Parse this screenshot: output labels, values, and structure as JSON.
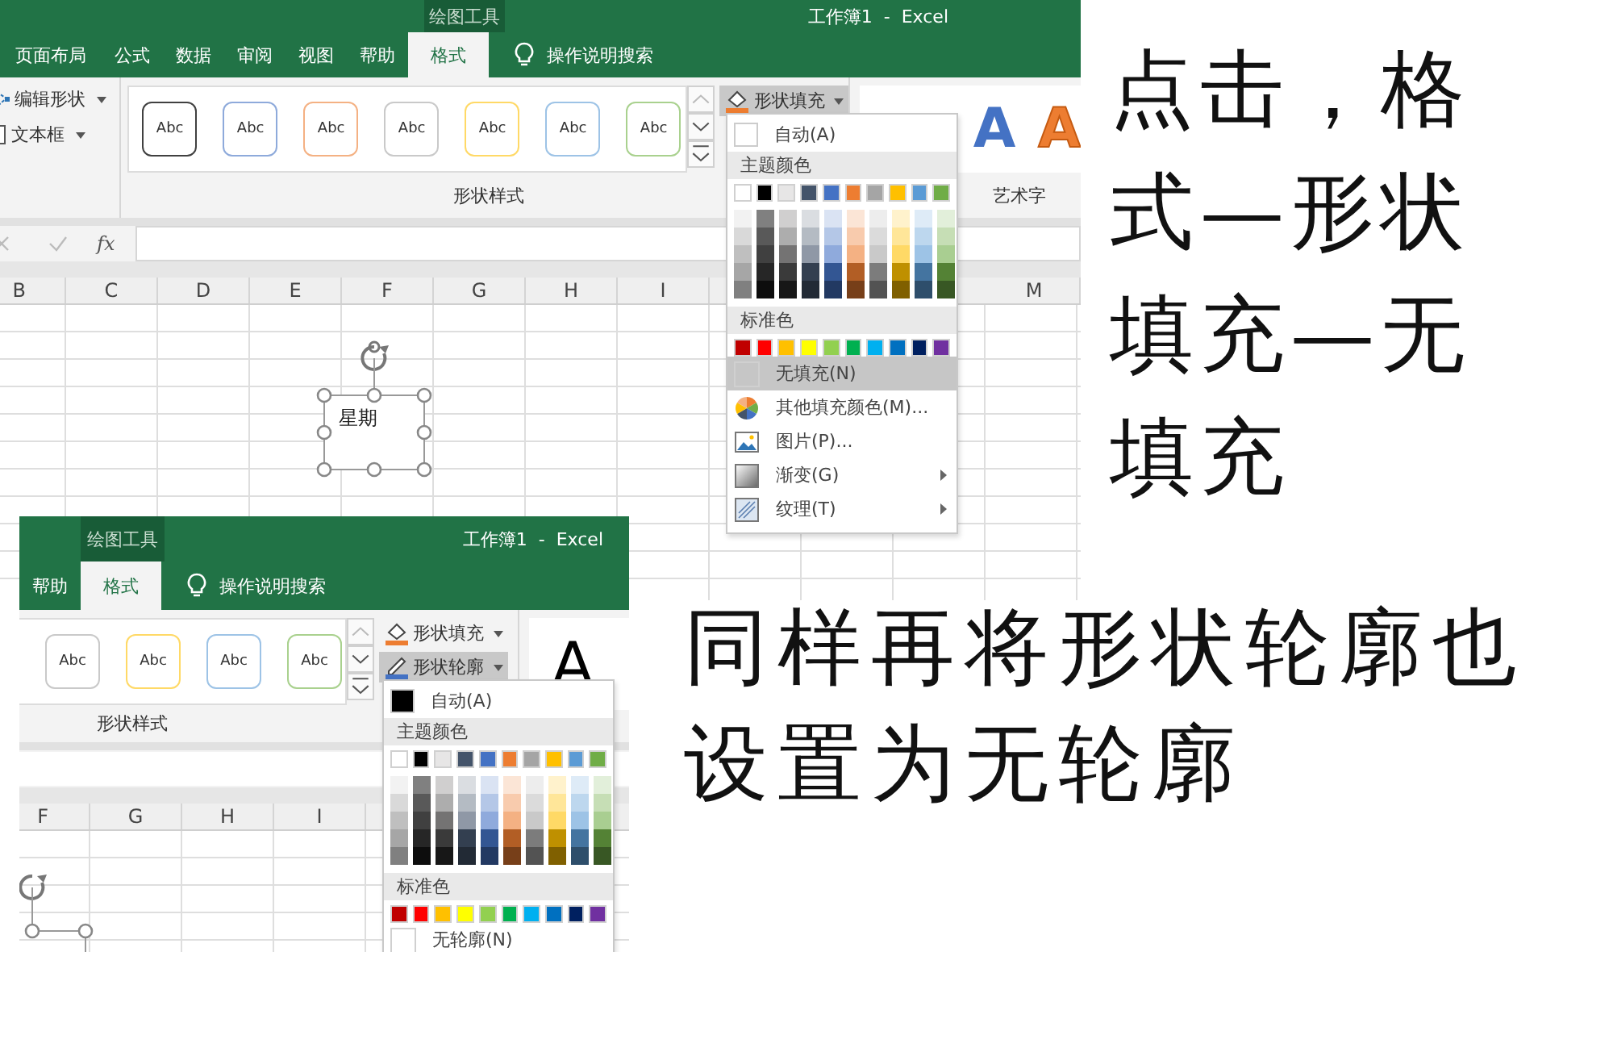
{
  "screenshot_1": {
    "context_tab": "绘图工具",
    "title": "工作簿1  -  Excel",
    "tabs": [
      {
        "label": "页面布局",
        "selected": false
      },
      {
        "label": "公式",
        "selected": false
      },
      {
        "label": "数据",
        "selected": false
      },
      {
        "label": "审阅",
        "selected": false
      },
      {
        "label": "视图",
        "selected": false
      },
      {
        "label": "帮助",
        "selected": false
      },
      {
        "label": "格式",
        "selected": true
      }
    ],
    "search": "操作说明搜索",
    "shape_tools": [
      {
        "label": "编辑形状"
      },
      {
        "label": "文本框"
      }
    ],
    "style_gallery": [
      {
        "label": "Abc",
        "color": "#404040"
      },
      {
        "label": "Abc",
        "color": "#8eaadb"
      },
      {
        "label": "Abc",
        "color": "#f4b183"
      },
      {
        "label": "Abc",
        "color": "#c9c9c9"
      },
      {
        "label": "Abc",
        "color": "#ffd966"
      },
      {
        "label": "Abc",
        "color": "#9dc3e6"
      },
      {
        "label": "Abc",
        "color": "#a9d18e"
      }
    ],
    "group_label": "形状样式",
    "menu_buttons": [
      {
        "label": "形状填充",
        "kind": "fill",
        "selected": true
      }
    ],
    "wordart": {
      "samples": [
        {
          "text": "A",
          "kind": "fill",
          "color": "#4472c4"
        },
        {
          "text": "A",
          "kind": "outline",
          "color": "#ed7d31"
        }
      ],
      "group_label": "艺术字"
    },
    "formula_bar": {
      "function_label": "fx"
    },
    "columns": [
      "B",
      "C",
      "D",
      "E",
      "F",
      "G",
      "H",
      "I",
      "M"
    ],
    "shape": {
      "text": "星期"
    },
    "menu": {
      "auto": {
        "label": "自动(A)",
        "color": "#ffffff"
      },
      "theme_heading": "主题颜色",
      "theme_colors": [
        {
          "color": "#ffffff"
        },
        {
          "color": "#000000"
        },
        {
          "color": "#e7e6e6"
        },
        {
          "color": "#44546a"
        },
        {
          "color": "#4472c4"
        },
        {
          "color": "#ed7d31"
        },
        {
          "color": "#a5a5a5"
        },
        {
          "color": "#ffc000"
        },
        {
          "color": "#5b9bd5"
        },
        {
          "color": "#70ad47"
        }
      ],
      "standard_heading": "标准色",
      "standard_colors": [
        {
          "color": "#c00000"
        },
        {
          "color": "#ff0000"
        },
        {
          "color": "#ffc000"
        },
        {
          "color": "#ffff00"
        },
        {
          "color": "#92d050"
        },
        {
          "color": "#00b050"
        },
        {
          "color": "#00b0f0"
        },
        {
          "color": "#0070c0"
        },
        {
          "color": "#002060"
        },
        {
          "color": "#7030a0"
        }
      ],
      "options": [
        {
          "label": "无填充(N)",
          "kind": "none",
          "selected": true,
          "submenu": false
        },
        {
          "label": "其他填充颜色(M)...",
          "kind": "palette",
          "selected": false,
          "submenu": false
        },
        {
          "label": "图片(P)...",
          "kind": "picture",
          "selected": false,
          "submenu": false
        },
        {
          "label": "渐变(G)",
          "kind": "gradient",
          "selected": false,
          "submenu": true
        },
        {
          "label": "纹理(T)",
          "kind": "texture",
          "selected": false,
          "submenu": true
        }
      ]
    }
  },
  "screenshot_2": {
    "context_tab": "绘图工具",
    "title": "工作簿1  -  Excel",
    "tabs": [
      {
        "label": "帮助",
        "selected": false
      },
      {
        "label": "格式",
        "selected": true
      }
    ],
    "search": "操作说明搜索",
    "style_gallery": [
      {
        "label": "Abc",
        "color": "#c9c9c9"
      },
      {
        "label": "Abc",
        "color": "#ffd966"
      },
      {
        "label": "Abc",
        "color": "#9dc3e6"
      },
      {
        "label": "Abc",
        "color": "#a9d18e"
      }
    ],
    "group_label": "形状样式",
    "menu_buttons": [
      {
        "label": "形状填充",
        "kind": "fill",
        "selected": false
      },
      {
        "label": "形状轮廓",
        "kind": "outline",
        "selected": true
      }
    ],
    "wordart": {
      "samples": [
        {
          "text": "A",
          "kind": "fill",
          "color": "#000000"
        }
      ]
    },
    "columns": [
      "F",
      "G",
      "H",
      "I"
    ],
    "menu": {
      "auto": {
        "label": "自动(A)",
        "color": "#000000"
      },
      "theme_heading": "主题颜色",
      "theme_colors": [
        {
          "color": "#ffffff"
        },
        {
          "color": "#000000"
        },
        {
          "color": "#e7e6e6"
        },
        {
          "color": "#44546a"
        },
        {
          "color": "#4472c4"
        },
        {
          "color": "#ed7d31"
        },
        {
          "color": "#a5a5a5"
        },
        {
          "color": "#ffc000"
        },
        {
          "color": "#5b9bd5"
        },
        {
          "color": "#70ad47"
        }
      ],
      "standard_heading": "标准色",
      "standard_colors": [
        {
          "color": "#c00000"
        },
        {
          "color": "#ff0000"
        },
        {
          "color": "#ffc000"
        },
        {
          "color": "#ffff00"
        },
        {
          "color": "#92d050"
        },
        {
          "color": "#00b050"
        },
        {
          "color": "#00b0f0"
        },
        {
          "color": "#0070c0"
        },
        {
          "color": "#002060"
        },
        {
          "color": "#7030a0"
        }
      ],
      "options": [
        {
          "label": "无轮廓(N)",
          "kind": "none",
          "selected": false,
          "submenu": false
        }
      ]
    }
  },
  "annotations": [
    "点击，格式—形状填充—无填充",
    "同样再将形状轮廓也设置为无轮廓"
  ]
}
